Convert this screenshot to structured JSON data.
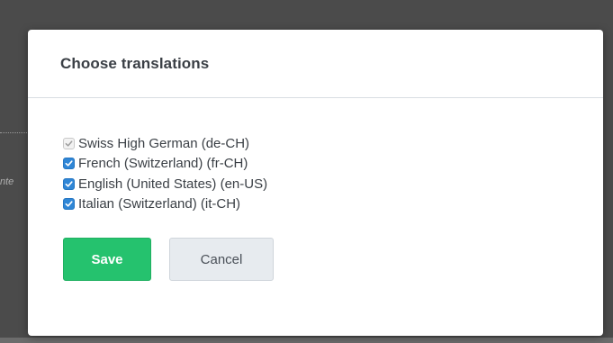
{
  "dialog": {
    "title": "Choose translations",
    "options": [
      {
        "label": "Swiss High German (de-CH)",
        "checked": true,
        "disabled": true
      },
      {
        "label": "French (Switzerland) (fr-CH)",
        "checked": true,
        "disabled": false
      },
      {
        "label": "English (United States) (en-US)",
        "checked": true,
        "disabled": false
      },
      {
        "label": "Italian (Switzerland) (it-CH)",
        "checked": true,
        "disabled": false
      }
    ],
    "save_label": "Save",
    "cancel_label": "Cancel"
  },
  "background": {
    "edge_text": "nte"
  },
  "colors": {
    "accent_check": "#2f86d6",
    "save_button": "#25c26e",
    "cancel_button": "#e7ebef"
  }
}
